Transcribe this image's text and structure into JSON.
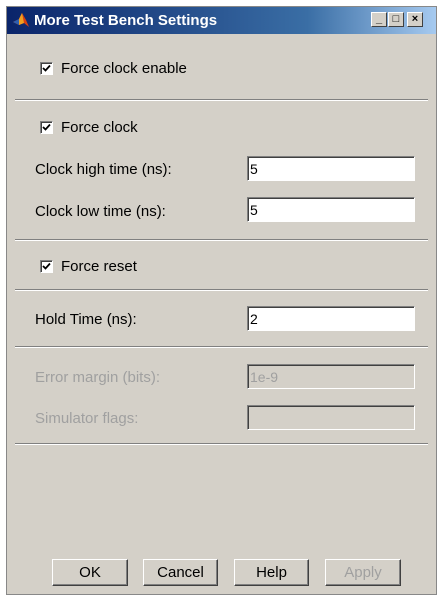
{
  "window": {
    "title": "More Test Bench Settings",
    "controls": {
      "minimize": "_",
      "maximize": "□",
      "close": "×"
    }
  },
  "settings": {
    "force_clock_enable": {
      "label": "Force clock enable",
      "checked": true
    },
    "force_clock": {
      "label": "Force clock",
      "checked": true
    },
    "clock_high_time": {
      "label": "Clock high time (ns):",
      "value": "5"
    },
    "clock_low_time": {
      "label": "Clock low time (ns):",
      "value": "5"
    },
    "force_reset": {
      "label": "Force reset",
      "checked": true
    },
    "hold_time": {
      "label": "Hold Time (ns):",
      "value": "2"
    },
    "error_margin": {
      "label": "Error margin (bits):",
      "value": "1e-9",
      "enabled": false
    },
    "simulator_flags": {
      "label": "Simulator flags:",
      "value": "",
      "enabled": false
    }
  },
  "buttons": {
    "ok": "OK",
    "cancel": "Cancel",
    "help": "Help",
    "apply": "Apply"
  },
  "icons": {
    "app": "matlab-membrane-icon",
    "check": "checkmark-icon"
  }
}
